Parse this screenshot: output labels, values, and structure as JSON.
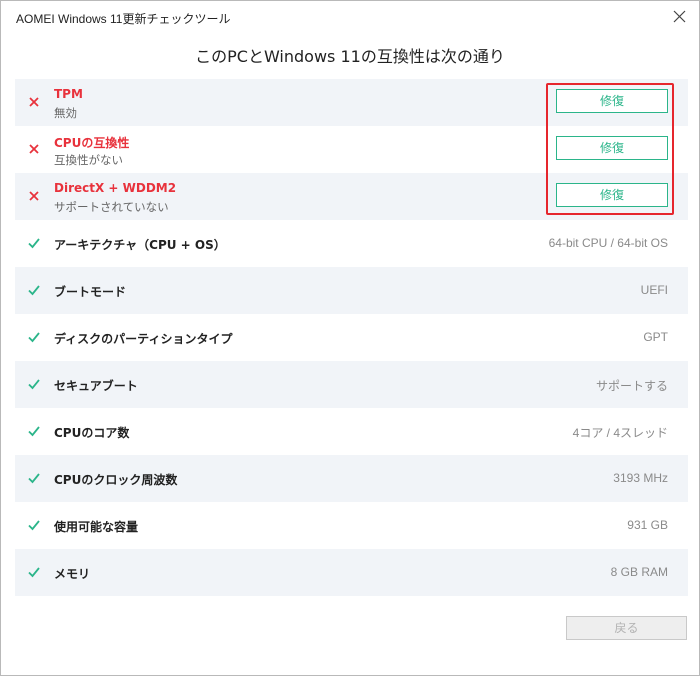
{
  "window": {
    "title": "AOMEI Windows 11更新チェックツール"
  },
  "heading": "このPCとWindows 11の互換性は次の通り",
  "failed_items": [
    {
      "label": "TPM",
      "status": "無効",
      "fix_label": "修復"
    },
    {
      "label": "CPUの互換性",
      "status": "互換性がない",
      "fix_label": "修復"
    },
    {
      "label": "DirectX + WDDM2",
      "status": "サポートされていない",
      "fix_label": "修復"
    }
  ],
  "passed_items": [
    {
      "label": "アーキテクチャ（CPU + OS）",
      "value": "64-bit CPU / 64-bit OS"
    },
    {
      "label": "ブートモード",
      "value": "UEFI"
    },
    {
      "label": "ディスクのパーティションタイプ",
      "value": "GPT"
    },
    {
      "label": "セキュアブート",
      "value": "サポートする"
    },
    {
      "label": "CPUのコア数",
      "value": "4コア / 4スレッド"
    },
    {
      "label": "CPUのクロック周波数",
      "value": "3193 MHz"
    },
    {
      "label": "使用可能な容量",
      "value": "931 GB"
    },
    {
      "label": "メモリ",
      "value": "8 GB RAM"
    }
  ],
  "footer": {
    "back_label": "戻る"
  },
  "colors": {
    "fail": "#e8323c",
    "pass": "#2bb58a",
    "highlight": "#e6262d",
    "row_tint": "#f1f4f8"
  }
}
